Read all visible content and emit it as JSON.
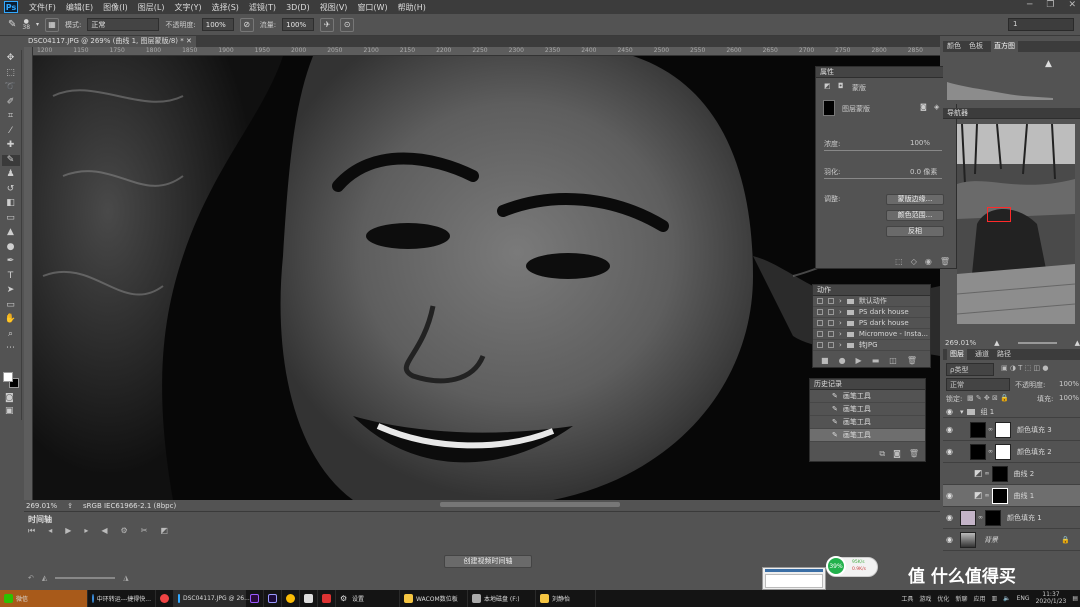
{
  "menubar": {
    "items": [
      "文件(F)",
      "编辑(E)",
      "图像(I)",
      "图层(L)",
      "文字(Y)",
      "选择(S)",
      "滤镜(T)",
      "3D(D)",
      "视图(V)",
      "窗口(W)",
      "帮助(H)"
    ],
    "logo": "Ps"
  },
  "options": {
    "brush_size": "38",
    "mode_label": "模式:",
    "mode_value": "正常",
    "opacity_label": "不透明度:",
    "opacity_value": "100%",
    "flow_label": "流量:",
    "flow_value": "100%",
    "workspace": "1"
  },
  "document": {
    "tab_title": "DSC04117.JPG @ 269% (曲线 1, 图层蒙版/8) *",
    "zoom": "269.01%",
    "profile": "sRGB IEC61966-2.1 (8bpc)",
    "ruler_ticks": [
      "1200",
      "1150",
      "1750",
      "1800",
      "1850",
      "1900",
      "1950",
      "2000",
      "2050",
      "2100",
      "2150",
      "2200",
      "2250",
      "2300",
      "2350",
      "2400",
      "2450",
      "2500",
      "2550",
      "2600",
      "2650",
      "2700",
      "2750",
      "2800",
      "2850"
    ]
  },
  "timeline": {
    "title": "时间轴",
    "create_button": "创建视频时间轴"
  },
  "properties": {
    "title": "属性",
    "mask_type": "蒙版",
    "layer_mask": "图层蒙版",
    "density_label": "浓度:",
    "density_value": "100%",
    "feather_label": "羽化:",
    "feather_value": "0.0 像素",
    "adjust_label": "调整:",
    "btn_mask_edge": "蒙版边缘...",
    "btn_color_range": "颜色范围...",
    "btn_invert": "反相"
  },
  "actions": {
    "title": "动作",
    "items": [
      "默认动作",
      "PS dark house",
      "PS dark house",
      "Micromove - Insta...",
      "转JPG"
    ]
  },
  "history": {
    "title": "历史记录",
    "items": [
      "画笔工具",
      "画笔工具",
      "画笔工具",
      "画笔工具"
    ]
  },
  "right": {
    "tabs": [
      "颜色",
      "色板",
      "直方图"
    ],
    "nav_label": "导航器",
    "nav_zoom": "269.01%",
    "layer_tabs": [
      "图层",
      "通道",
      "路径"
    ],
    "kind_label": "ρ类型",
    "blend_mode": "正常",
    "opacity_label": "不透明度:",
    "opacity_value": "100%",
    "lock_label": "锁定:",
    "fill_label": "填充:",
    "fill_value": "100%",
    "layers": [
      "组 1",
      "颜色填充 3",
      "颜色填充 2",
      "曲线 2",
      "曲线 1",
      "颜色填充 1",
      "背景"
    ]
  },
  "taskbar": {
    "items": [
      "微信",
      "中环转运---捷得快...",
      "DSC04117.JPG @ 26...",
      "设置",
      "WACOM数位板",
      "本地磁盘 (F:)",
      "刘静怡"
    ],
    "tray": [
      "工具",
      "游戏",
      "优化",
      "新聊",
      "应用"
    ],
    "time": "11:37",
    "date": "2020/1/23",
    "lang": "ENG"
  },
  "overlay": {
    "net_pct": "39%",
    "net_up": "95K/s",
    "net_down": "0.9K/s",
    "watermark": "值 什么值得买"
  },
  "colors": {
    "accent": "#31a8ff",
    "selection": "#6e6e6e",
    "nav_frame": "#ff2a2a"
  }
}
